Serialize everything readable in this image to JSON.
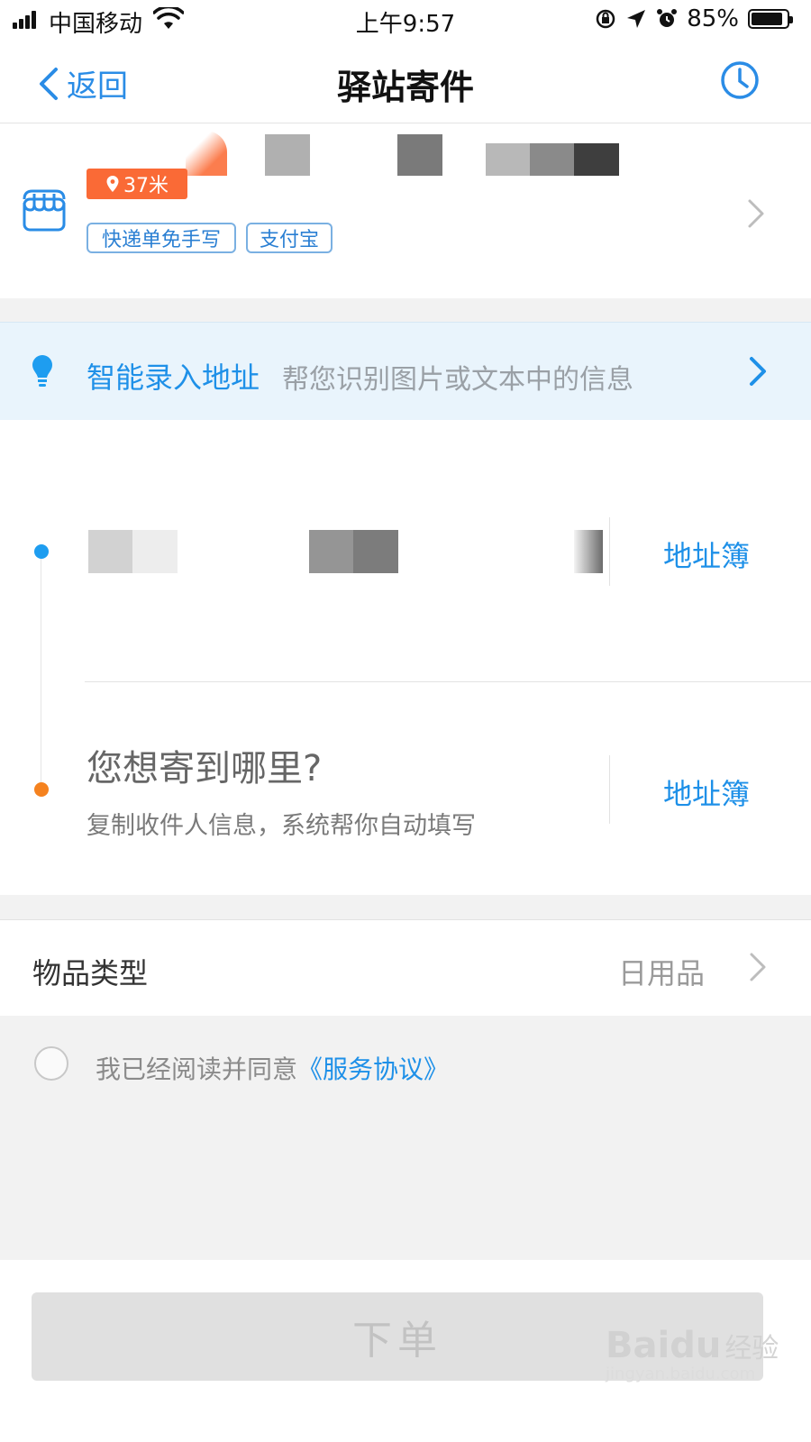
{
  "status_bar": {
    "carrier": "中国移动",
    "time": "上午9:57",
    "battery_percent": "85%",
    "battery_level": 0.85
  },
  "nav": {
    "back_label": "返回",
    "title": "驿站寄件"
  },
  "station": {
    "distance": "37米",
    "tags": [
      "快递单免手写",
      "支付宝"
    ]
  },
  "smart_input": {
    "label": "智能录入地址",
    "hint": "帮您识别图片或文本中的信息"
  },
  "sender": {
    "address_book_label": "地址簿"
  },
  "recipient": {
    "title": "您想寄到哪里?",
    "subtitle": "复制收件人信息，系统帮你自动填写",
    "address_book_label": "地址簿"
  },
  "goods": {
    "label": "物品类型",
    "value": "日用品"
  },
  "agreement": {
    "text": "我已经阅读并同意",
    "link": "《服务协议》",
    "checked": false
  },
  "submit_label": "下单",
  "watermark": {
    "brand": "Baidu",
    "suffix": "经验",
    "url": "jingyan.baidu.com"
  },
  "colors": {
    "accent_blue": "#1e90e8",
    "badge_orange": "#fa6a36",
    "dot_orange": "#f5821f"
  }
}
